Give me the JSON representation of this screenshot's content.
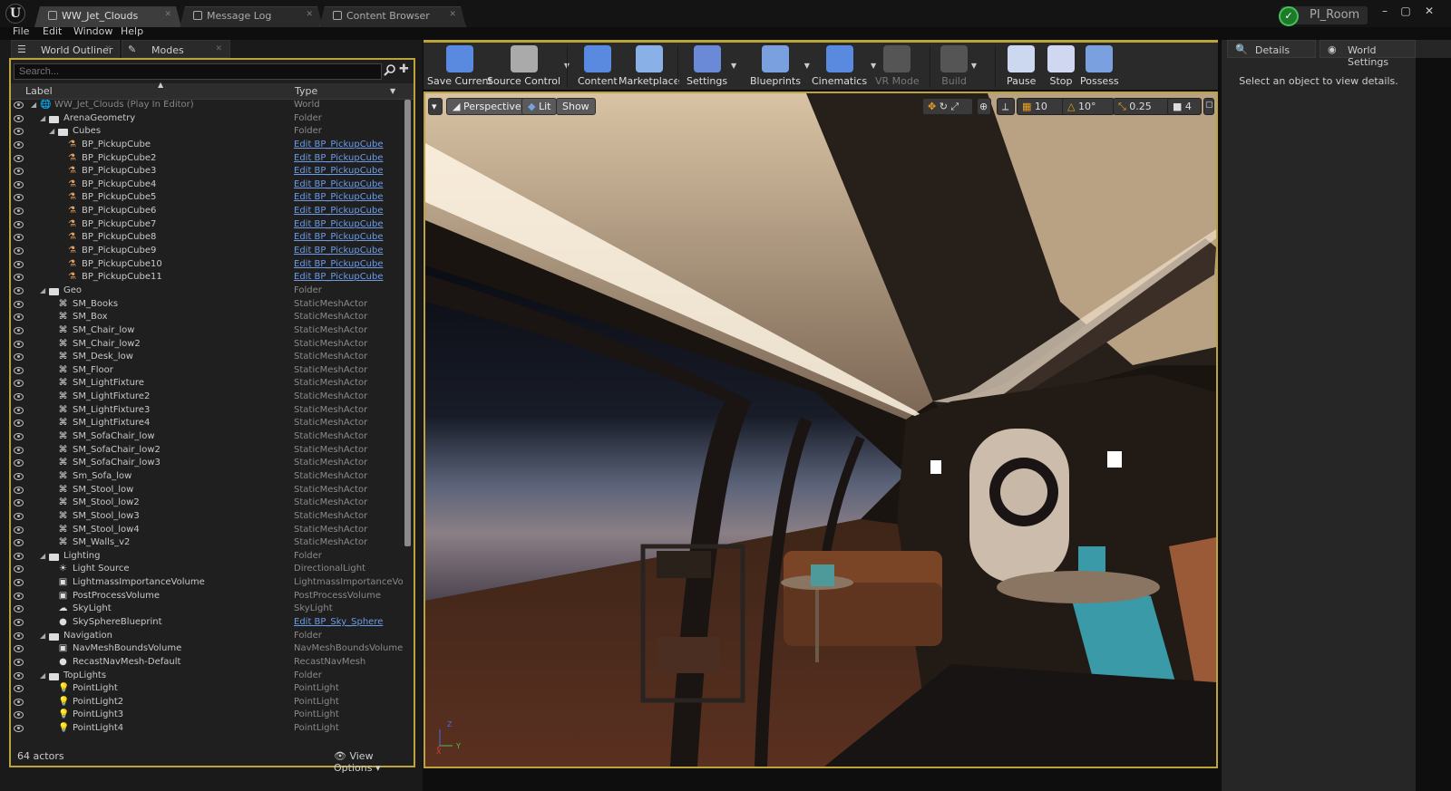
{
  "titlebar": {
    "tabs": [
      {
        "label": "WW_Jet_Clouds",
        "active": true
      },
      {
        "label": "Message Log",
        "active": false
      },
      {
        "label": "Content Browser",
        "active": false
      }
    ],
    "project": "PI_Room",
    "window_controls": [
      "minimize-icon",
      "maximize-icon",
      "close-icon"
    ]
  },
  "menu": [
    "File",
    "Edit",
    "Window",
    "Help"
  ],
  "left_tabs": [
    "World Outliner",
    "Modes"
  ],
  "outliner": {
    "search_placeholder": "Search...",
    "columns": [
      "Label",
      "Type"
    ],
    "rows": [
      {
        "label": "WW_Jet_Clouds (Play In Editor)",
        "type": "World",
        "depth": 0,
        "icon": "world",
        "dim": true
      },
      {
        "label": "ArenaGeometry",
        "type": "Folder",
        "depth": 1,
        "icon": "folder"
      },
      {
        "label": "Cubes",
        "type": "Folder",
        "depth": 2,
        "icon": "folder"
      },
      {
        "label": "BP_PickupCube",
        "type": "Edit BP_PickupCube",
        "depth": 3,
        "icon": "blueprint",
        "link": true
      },
      {
        "label": "BP_PickupCube2",
        "type": "Edit BP_PickupCube",
        "depth": 3,
        "icon": "blueprint",
        "link": true
      },
      {
        "label": "BP_PickupCube3",
        "type": "Edit BP_PickupCube",
        "depth": 3,
        "icon": "blueprint",
        "link": true
      },
      {
        "label": "BP_PickupCube4",
        "type": "Edit BP_PickupCube",
        "depth": 3,
        "icon": "blueprint",
        "link": true
      },
      {
        "label": "BP_PickupCube5",
        "type": "Edit BP_PickupCube",
        "depth": 3,
        "icon": "blueprint",
        "link": true
      },
      {
        "label": "BP_PickupCube6",
        "type": "Edit BP_PickupCube",
        "depth": 3,
        "icon": "blueprint",
        "link": true
      },
      {
        "label": "BP_PickupCube7",
        "type": "Edit BP_PickupCube",
        "depth": 3,
        "icon": "blueprint",
        "link": true
      },
      {
        "label": "BP_PickupCube8",
        "type": "Edit BP_PickupCube",
        "depth": 3,
        "icon": "blueprint",
        "link": true
      },
      {
        "label": "BP_PickupCube9",
        "type": "Edit BP_PickupCube",
        "depth": 3,
        "icon": "blueprint",
        "link": true
      },
      {
        "label": "BP_PickupCube10",
        "type": "Edit BP_PickupCube",
        "depth": 3,
        "icon": "blueprint",
        "link": true
      },
      {
        "label": "BP_PickupCube11",
        "type": "Edit BP_PickupCube",
        "depth": 3,
        "icon": "blueprint",
        "link": true
      },
      {
        "label": "Geo",
        "type": "Folder",
        "depth": 1,
        "icon": "folder"
      },
      {
        "label": "SM_Books",
        "type": "StaticMeshActor",
        "depth": 2,
        "icon": "mesh"
      },
      {
        "label": "SM_Box",
        "type": "StaticMeshActor",
        "depth": 2,
        "icon": "mesh"
      },
      {
        "label": "SM_Chair_low",
        "type": "StaticMeshActor",
        "depth": 2,
        "icon": "mesh"
      },
      {
        "label": "SM_Chair_low2",
        "type": "StaticMeshActor",
        "depth": 2,
        "icon": "mesh"
      },
      {
        "label": "SM_Desk_low",
        "type": "StaticMeshActor",
        "depth": 2,
        "icon": "mesh"
      },
      {
        "label": "SM_Floor",
        "type": "StaticMeshActor",
        "depth": 2,
        "icon": "mesh"
      },
      {
        "label": "SM_LightFixture",
        "type": "StaticMeshActor",
        "depth": 2,
        "icon": "mesh"
      },
      {
        "label": "SM_LightFixture2",
        "type": "StaticMeshActor",
        "depth": 2,
        "icon": "mesh"
      },
      {
        "label": "SM_LightFixture3",
        "type": "StaticMeshActor",
        "depth": 2,
        "icon": "mesh"
      },
      {
        "label": "SM_LightFixture4",
        "type": "StaticMeshActor",
        "depth": 2,
        "icon": "mesh"
      },
      {
        "label": "SM_SofaChair_low",
        "type": "StaticMeshActor",
        "depth": 2,
        "icon": "mesh"
      },
      {
        "label": "SM_SofaChair_low2",
        "type": "StaticMeshActor",
        "depth": 2,
        "icon": "mesh"
      },
      {
        "label": "SM_SofaChair_low3",
        "type": "StaticMeshActor",
        "depth": 2,
        "icon": "mesh"
      },
      {
        "label": "Sm_Sofa_low",
        "type": "StaticMeshActor",
        "depth": 2,
        "icon": "mesh"
      },
      {
        "label": "SM_Stool_low",
        "type": "StaticMeshActor",
        "depth": 2,
        "icon": "mesh"
      },
      {
        "label": "SM_Stool_low2",
        "type": "StaticMeshActor",
        "depth": 2,
        "icon": "mesh"
      },
      {
        "label": "SM_Stool_low3",
        "type": "StaticMeshActor",
        "depth": 2,
        "icon": "mesh"
      },
      {
        "label": "SM_Stool_low4",
        "type": "StaticMeshActor",
        "depth": 2,
        "icon": "mesh"
      },
      {
        "label": "SM_Walls_v2",
        "type": "StaticMeshActor",
        "depth": 2,
        "icon": "mesh"
      },
      {
        "label": "Lighting",
        "type": "Folder",
        "depth": 1,
        "icon": "folder"
      },
      {
        "label": "Light Source",
        "type": "DirectionalLight",
        "depth": 2,
        "icon": "sun"
      },
      {
        "label": "LightmassImportanceVolume",
        "type": "LightmassImportanceVolur",
        "depth": 2,
        "icon": "volume"
      },
      {
        "label": "PostProcessVolume",
        "type": "PostProcessVolume",
        "depth": 2,
        "icon": "volume"
      },
      {
        "label": "SkyLight",
        "type": "SkyLight",
        "depth": 2,
        "icon": "sky"
      },
      {
        "label": "SkySphereBlueprint",
        "type": "Edit BP_Sky_Sphere",
        "depth": 2,
        "icon": "sphere",
        "link": true
      },
      {
        "label": "Navigation",
        "type": "Folder",
        "depth": 1,
        "icon": "folder"
      },
      {
        "label": "NavMeshBoundsVolume",
        "type": "NavMeshBoundsVolume",
        "depth": 2,
        "icon": "volume"
      },
      {
        "label": "RecastNavMesh-Default",
        "type": "RecastNavMesh",
        "depth": 2,
        "icon": "sphere"
      },
      {
        "label": "TopLights",
        "type": "Folder",
        "depth": 1,
        "icon": "folder"
      },
      {
        "label": "PointLight",
        "type": "PointLight",
        "depth": 2,
        "icon": "bulb"
      },
      {
        "label": "PointLight2",
        "type": "PointLight",
        "depth": 2,
        "icon": "bulb"
      },
      {
        "label": "PointLight3",
        "type": "PointLight",
        "depth": 2,
        "icon": "bulb"
      },
      {
        "label": "PointLight4",
        "type": "PointLight",
        "depth": 2,
        "icon": "bulb"
      }
    ],
    "actor_count": "64 actors",
    "view_options": "View Options"
  },
  "toolbar": [
    {
      "label": "Save Current",
      "icon": "save-icon",
      "dropdown": false
    },
    {
      "label": "Source Control",
      "icon": "source-control-icon",
      "dropdown": true
    },
    {
      "label": "Content",
      "icon": "content-icon",
      "dropdown": false
    },
    {
      "label": "Marketplace",
      "icon": "marketplace-icon",
      "dropdown": false
    },
    {
      "label": "Settings",
      "icon": "settings-icon",
      "dropdown": true
    },
    {
      "label": "Blueprints",
      "icon": "blueprints-icon",
      "dropdown": true
    },
    {
      "label": "Cinematics",
      "icon": "cinematics-icon",
      "dropdown": true
    },
    {
      "label": "VR Mode",
      "icon": "vr-icon",
      "dropdown": false,
      "disabled": true
    },
    {
      "label": "Build",
      "icon": "build-icon",
      "dropdown": true,
      "disabled": true
    },
    {
      "label": "Pause",
      "icon": "pause-icon",
      "dropdown": false
    },
    {
      "label": "Stop",
      "icon": "stop-icon",
      "dropdown": false
    },
    {
      "label": "Possess",
      "icon": "possess-icon",
      "dropdown": false
    }
  ],
  "viewport": {
    "view_mode": "Perspective",
    "lighting": "Lit",
    "show": "Show",
    "grid_snap": "10",
    "rotation_snap": "10°",
    "scale_snap": "0.25",
    "camera_speed": "4",
    "axis_labels": [
      "Z",
      "Y",
      "X"
    ]
  },
  "right_tabs": [
    "Details",
    "World Settings"
  ],
  "details_message": "Select an object to view details.",
  "colors": {
    "accent": "#bca43a",
    "link": "#6c9be8",
    "panel": "#1f1f1f"
  }
}
